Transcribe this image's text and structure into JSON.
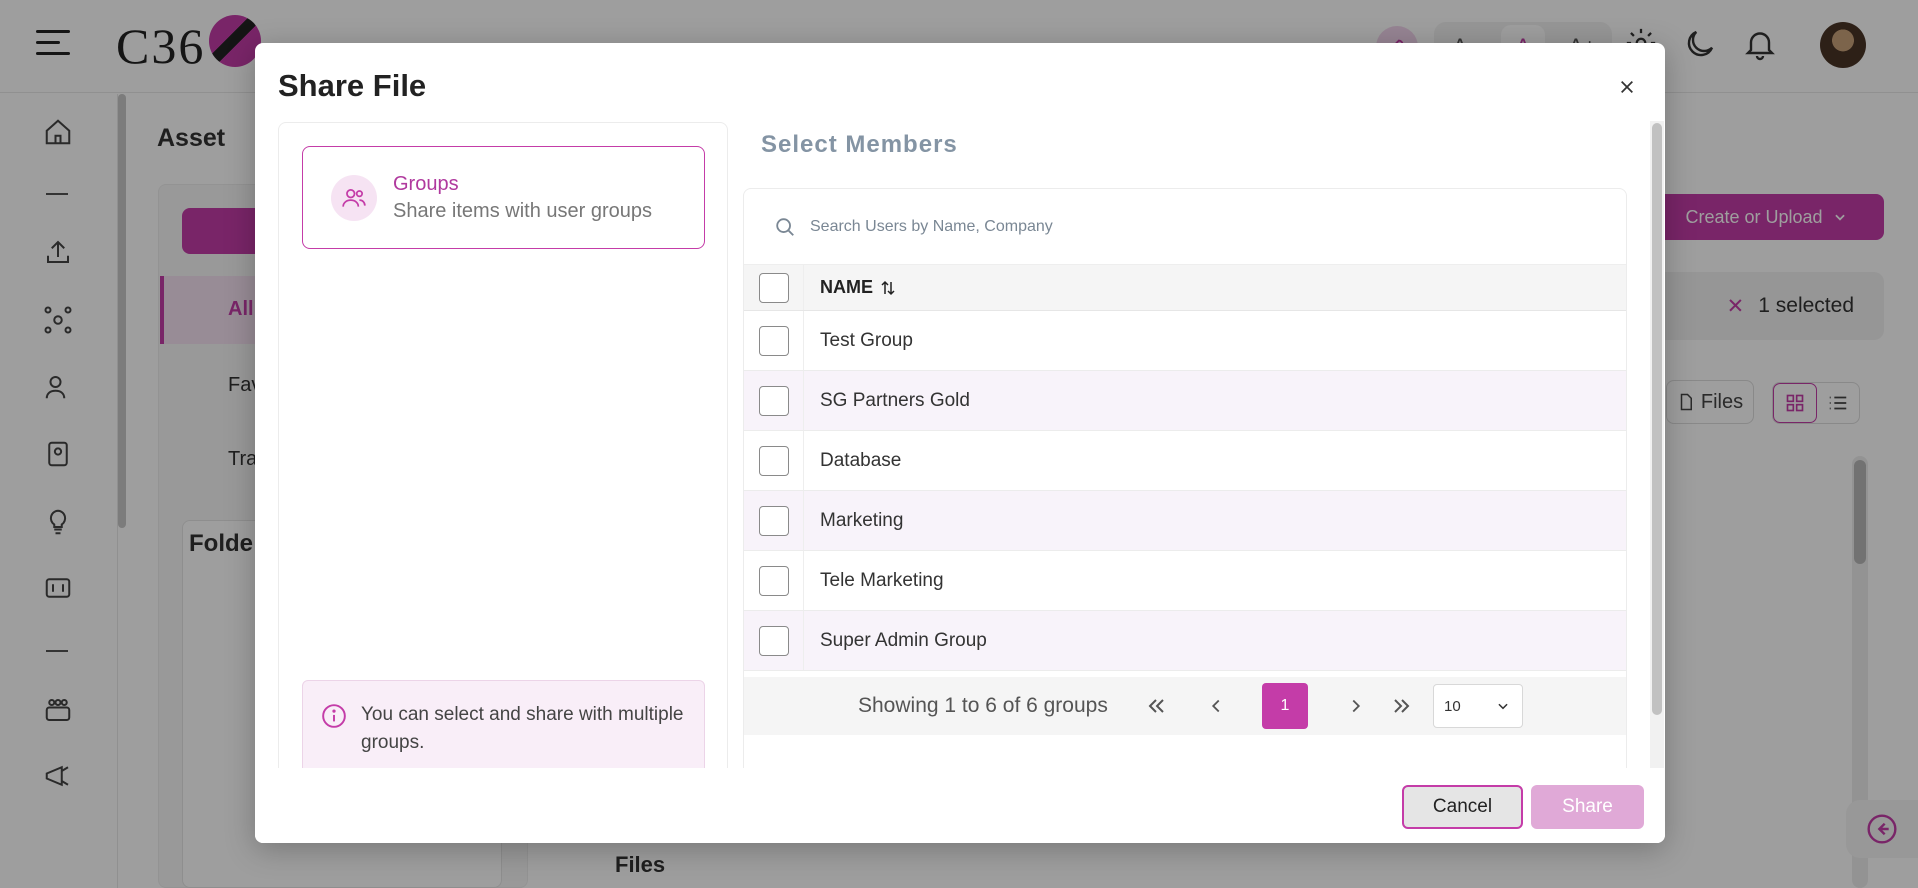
{
  "app": {
    "logo_text": "C36",
    "page_title": "Asset",
    "font_size_options": [
      "A-",
      "A",
      "A+"
    ],
    "nav": {
      "all_label": "All",
      "favorites_label": "Fav",
      "trash_label": "Tra"
    },
    "folders_title": "Folde",
    "files_title": "Files",
    "create_button_label": "Create or Upload",
    "selected_text": "1 selected",
    "files_filter_label": "Files"
  },
  "modal": {
    "title": "Share File",
    "share_type": {
      "label": "Groups",
      "description": "Share items with user groups"
    },
    "info_text": "You can select and share with multiple groups.",
    "members": {
      "title": "Select Members",
      "search_placeholder": "Search Users by Name, Company",
      "column_name": "NAME",
      "rows": [
        {
          "name": "Test Group"
        },
        {
          "name": "SG Partners Gold"
        },
        {
          "name": "Database"
        },
        {
          "name": "Marketing"
        },
        {
          "name": "Tele Marketing"
        },
        {
          "name": "Super Admin Group"
        }
      ],
      "pagination": {
        "summary": "Showing 1 to 6 of 6 groups",
        "current_page": "1",
        "page_size": "10"
      }
    },
    "cancel_label": "Cancel",
    "share_label": "Share"
  },
  "colors": {
    "accent": "#c43ca8",
    "accent_light": "#f6e3f3",
    "share_disabled": "#e0a9d7"
  }
}
